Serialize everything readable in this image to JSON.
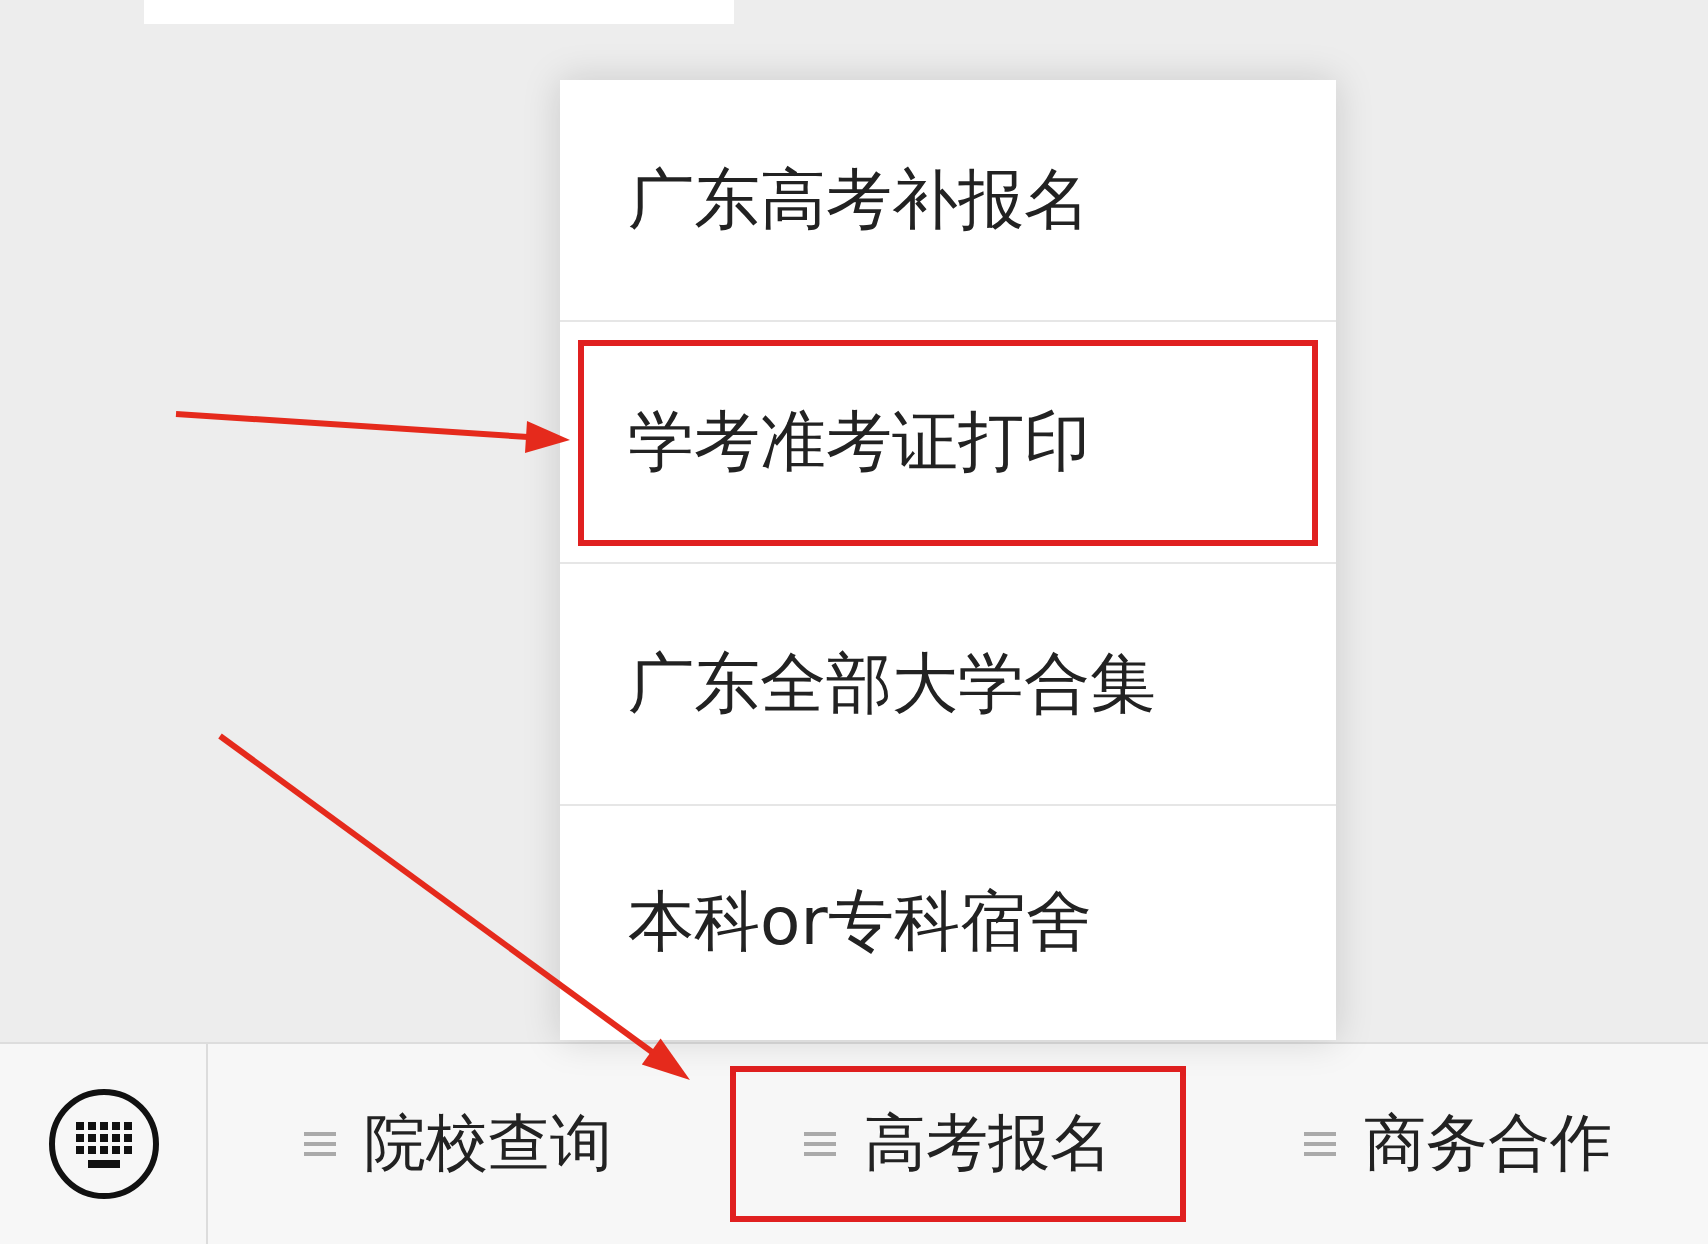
{
  "popup_menu": {
    "items": [
      {
        "label": "广东高考补报名",
        "highlighted": false
      },
      {
        "label": "学考准考证打印",
        "highlighted": true
      },
      {
        "label": "广东全部大学合集",
        "highlighted": false
      },
      {
        "label": "本科or专科宿舍",
        "highlighted": false
      }
    ]
  },
  "bottom_menu": {
    "items": [
      {
        "label": "院校查询",
        "highlighted": false
      },
      {
        "label": "高考报名",
        "highlighted": true
      },
      {
        "label": "商务合作",
        "highlighted": false
      }
    ]
  }
}
